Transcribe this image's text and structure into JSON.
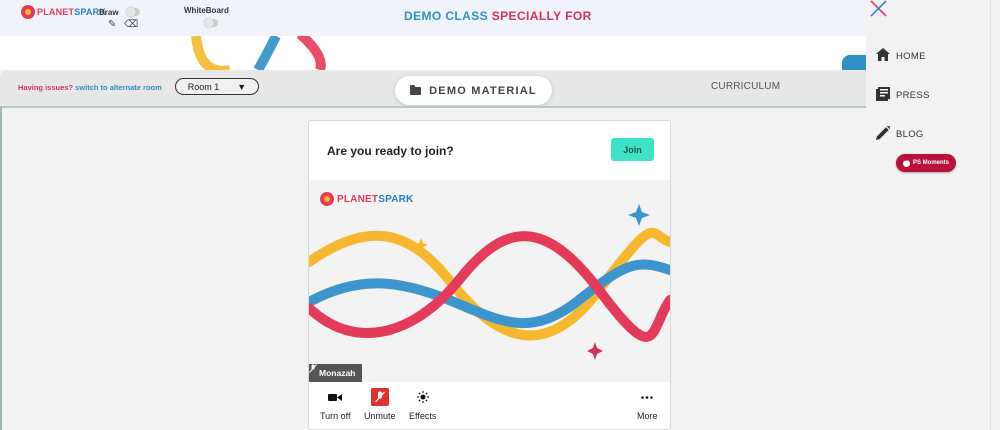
{
  "topbar": {
    "logo_planet": "PLANET",
    "logo_spark": "SPARK",
    "draw_label": "Draw",
    "whiteboard_label": "WhiteBoard",
    "headline_blue": "DEMO CLASS",
    "headline_red": "SPECIALLY FOR"
  },
  "roombar": {
    "issues_text": "Having issues?",
    "switch_link": "switch to alternate room",
    "room_value": "Room 1",
    "demo_tab": "DEMO MATERIAL",
    "curriculum_tab": "CURRICULUM"
  },
  "card": {
    "title": "Are you ready to join?",
    "join_label": "Join",
    "participant_name": "Monazah",
    "controls": [
      {
        "label": "Turn off",
        "icon": "camera-icon"
      },
      {
        "label": "Unmute",
        "icon": "mic-muted-icon"
      },
      {
        "label": "Effects",
        "icon": "sparkle-icon"
      },
      {
        "label": "More",
        "icon": "more-dots-icon"
      }
    ]
  },
  "side_menu": {
    "items": [
      {
        "label": "HOME",
        "icon": "home-icon"
      },
      {
        "label": "PRESS",
        "icon": "newspaper-icon"
      },
      {
        "label": "BLOG",
        "icon": "pencil-icon"
      }
    ],
    "ps_moments": "PS Moments"
  },
  "colors": {
    "brand_red": "#e53b5a",
    "brand_blue": "#2f8fc7",
    "brand_yellow": "#f5b82e",
    "join_green": "#3ee2c6",
    "ps_badge": "#b8123c"
  }
}
